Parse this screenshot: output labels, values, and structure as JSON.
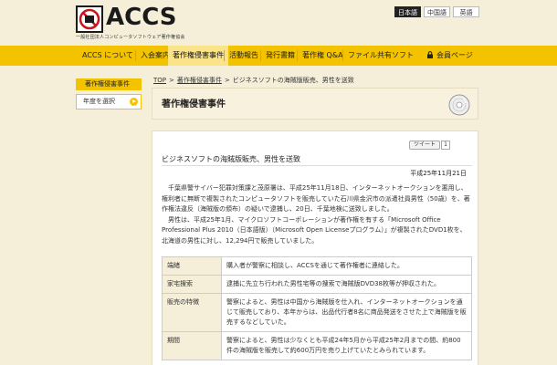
{
  "header": {
    "logo_text": "ACCS",
    "logo_subtitle": "一般社団法人コンピュータソフトウェア著作権協会",
    "languages": [
      "日本語",
      "中国語",
      "英語"
    ]
  },
  "nav": {
    "items": [
      "ACCS について",
      "入会案内",
      "著作権侵害事件",
      "活動報告",
      "発行書籍",
      "著作権 Q&A",
      "ファイル共有ソフト"
    ],
    "member": "会員ページ"
  },
  "sidebar": {
    "heading": "著作権侵害事件",
    "item": "年度を選択"
  },
  "breadcrumb": {
    "top": "TOP",
    "section": "著作権侵害事件",
    "current": "ビジネスソフトの海賊版販売、男性を送致"
  },
  "page": {
    "title": "著作権侵害事件"
  },
  "article": {
    "tweet": "ツイート",
    "tweet_count": "1",
    "title": "ビジネスソフトの海賊版販売、男性を送致",
    "date": "平成25年11月21日",
    "paragraphs": [
      "千葉県警サイバー犯罪対策課と茂原署は、平成25年11月18日、インターネットオークションを悪用し、権利者に無断で複製されたコンピュータソフトを販売していた石川県金沢市の派遣社員男性（50歳）を、著作権法違反（海賊版の頒布）の疑いで逮捕し、20日、千葉地検に送致しました。",
      "男性は、平成25年1月、マイクロソフトコーポレーションが著作権を有する「Microsoft Office Professional Plus 2010（日本語版）（Microsoft Open Licenseプログラム）」が複製されたDVD1枚を、北海道の男性に対し、12,294円で販売していました。"
    ],
    "table": [
      {
        "key": "端緒",
        "value": "購入者が警察に相談し、ACCSを通じて著作権者に連絡した。"
      },
      {
        "key": "家宅捜索",
        "value": "逮捕に先立ち行われた男性宅等の捜索で海賊版DVD38枚等が押収された。"
      },
      {
        "key": "販売の特徴",
        "value": "警察によると、男性は中国から海賊版を仕入れ、インターネットオークションを通じて販売しており、本年からは、出品代行者8名に商品発送をさせた上で海賊版を販売するなどしていた。"
      },
      {
        "key": "期間",
        "value": "警察によると、男性は少なくとも平成24年5月から平成25年2月までの間、約800件の海賊版を販売して約600万円を売り上げていたとみられています。"
      }
    ]
  },
  "colors": {
    "accent": "#f3c300",
    "background": "#f5efda"
  }
}
